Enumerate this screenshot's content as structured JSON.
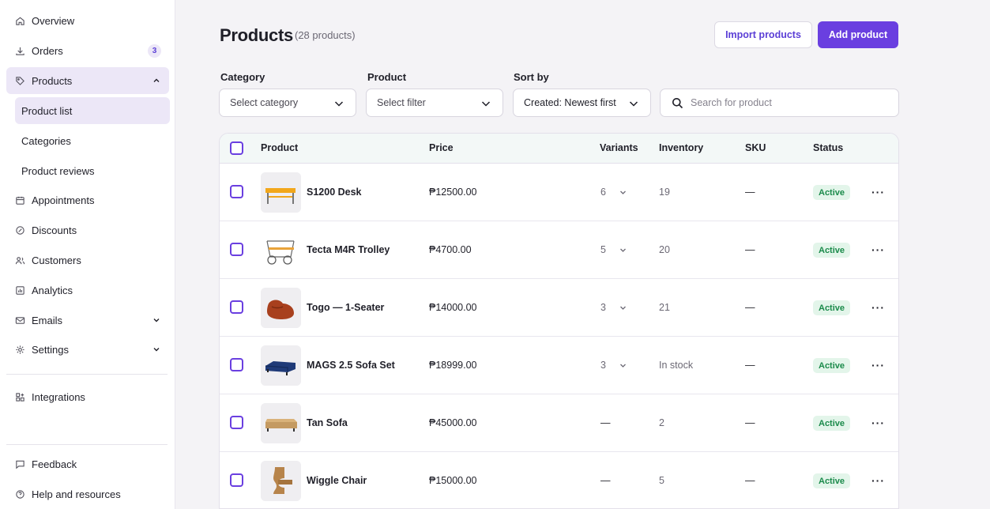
{
  "sidebar": {
    "overview": "Overview",
    "orders": "Orders",
    "orders_count": "3",
    "products": "Products",
    "product_list": "Product list",
    "categories": "Categories",
    "product_reviews": "Product reviews",
    "appointments": "Appointments",
    "discounts": "Discounts",
    "customers": "Customers",
    "analytics": "Analytics",
    "emails": "Emails",
    "settings": "Settings",
    "integrations": "Integrations",
    "feedback": "Feedback",
    "help": "Help and resources"
  },
  "header": {
    "title": "Products",
    "subtitle": "(28 products)",
    "import_label": "Import products",
    "add_label": "Add product"
  },
  "filters": {
    "category_label": "Category",
    "category_value": "Select category",
    "product_label": "Product",
    "product_value": "Select filter",
    "sort_label": "Sort by",
    "sort_value": "Created: Newest first",
    "search_placeholder": "Search for product"
  },
  "table": {
    "columns": {
      "product": "Product",
      "price": "Price",
      "variants": "Variants",
      "inventory": "Inventory",
      "sku": "SKU",
      "status": "Status"
    },
    "rows": [
      {
        "name": "S1200 Desk",
        "price": "₱12500.00",
        "variants": "6",
        "inventory": "19",
        "sku": "—",
        "status": "Active",
        "thumb": "desk-image"
      },
      {
        "name": "Tecta M4R Trolley",
        "price": "₱4700.00",
        "variants": "5",
        "inventory": "20",
        "sku": "—",
        "status": "Active",
        "thumb": "trolley-image"
      },
      {
        "name": "Togo — 1-Seater",
        "price": "₱14000.00",
        "variants": "3",
        "inventory": "21",
        "sku": "—",
        "status": "Active",
        "thumb": "lounge-chair-image"
      },
      {
        "name": "MAGS 2.5 Sofa Set",
        "price": "₱18999.00",
        "variants": "3",
        "inventory": "In stock",
        "sku": "—",
        "status": "Active",
        "thumb": "sofa-image"
      },
      {
        "name": "Tan Sofa",
        "price": "₱45000.00",
        "variants": "—",
        "inventory": "2",
        "sku": "—",
        "status": "Active",
        "thumb": "tan-sofa-image"
      },
      {
        "name": "Wiggle Chair",
        "price": "₱15000.00",
        "variants": "—",
        "inventory": "5",
        "sku": "—",
        "status": "Active",
        "thumb": "wiggle-chair-image"
      }
    ]
  },
  "colors": {
    "accent": "#6a3fe0",
    "active_bg": "#ece7f7",
    "status_bg": "#e3f5ea",
    "status_text": "#1a8a4a"
  }
}
